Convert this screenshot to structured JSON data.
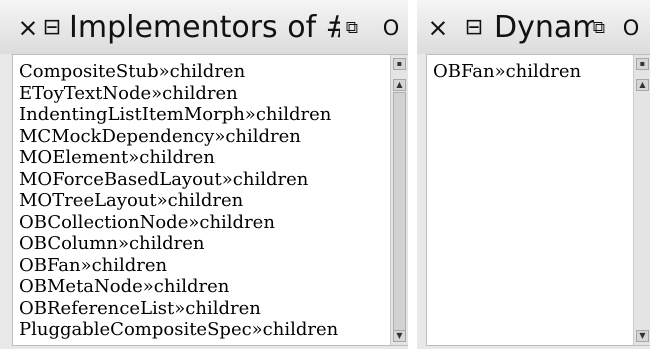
{
  "windows": [
    {
      "title": "Implementors of #",
      "icons": {
        "close": "×",
        "menu": "⊟",
        "collapse": "⧉",
        "expand": "O"
      },
      "items": [
        "CompositeStub»children",
        "EToyTextNode»children",
        "IndentingListItemMorph»children",
        "MCMockDependency»children",
        "MOElement»children",
        "MOForceBasedLayout»children",
        "MOTreeLayout»children",
        "OBCollectionNode»children",
        "OBColumn»children",
        "OBFan»children",
        "OBMetaNode»children",
        "OBReferenceList»children",
        "PluggableCompositeSpec»children"
      ]
    },
    {
      "title": "Dynam",
      "icons": {
        "close": "×",
        "menu": "⊟",
        "collapse": "⧉",
        "expand": "O"
      },
      "items": [
        "OBFan»children"
      ]
    }
  ],
  "scroll_icons": {
    "menu": "▪",
    "up": "▲",
    "down": "▼"
  },
  "colors": {
    "titlebar": "#e6e6e6",
    "list_background": "#ffffff",
    "text": "#000000"
  }
}
